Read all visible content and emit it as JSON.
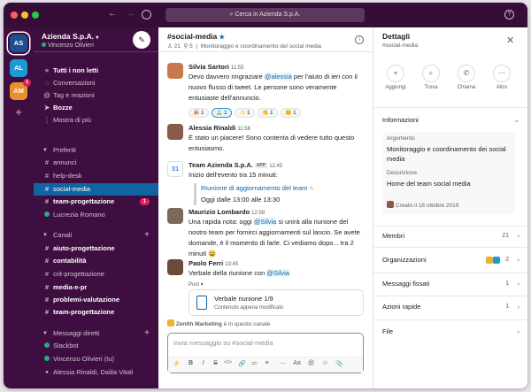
{
  "titlebar": {
    "search_placeholder": "Cerca in Azienda S.p.A.",
    "colors": {
      "close": "#ff5f57",
      "minimize": "#febc2e",
      "maximize": "#28c840"
    }
  },
  "rail": {
    "workspaces": [
      {
        "initials": "AS",
        "color": "#1d4f91",
        "selected": true
      },
      {
        "initials": "AL",
        "color": "#1d9bd1"
      },
      {
        "initials": "AM",
        "color": "#e8912d",
        "badge": "1"
      }
    ],
    "add": "+"
  },
  "sidebar": {
    "workspace_name": "Azienda S.p.A.",
    "user": "Vincenzo Olivieri",
    "nav": [
      {
        "icon": "unreads-icon",
        "glyph": "≡",
        "label": "Tutti i non letti",
        "bold": true
      },
      {
        "icon": "threads-icon",
        "glyph": "◌",
        "label": "Conversazioni"
      },
      {
        "icon": "mentions-icon",
        "glyph": "@",
        "label": "Tag e reazioni"
      },
      {
        "icon": "drafts-icon",
        "glyph": "➤",
        "label": "Bozze",
        "bold": true
      },
      {
        "icon": "more-icon",
        "glyph": "⋮",
        "label": "Mostra di più"
      }
    ],
    "favorites_header": "Preferiti",
    "favorites": [
      {
        "prefix": "#",
        "label": "annunci"
      },
      {
        "prefix": "#",
        "label": "help-desk"
      },
      {
        "prefix": "#",
        "label": "social-media",
        "selected": true
      },
      {
        "prefix": "#",
        "label": "team-progettazione",
        "bold": true,
        "badge": "1"
      },
      {
        "prefix": "dot",
        "label": "Lucrezia Romano"
      }
    ],
    "channels_header": "Canali",
    "channels": [
      {
        "label": "aiuto-progettazione",
        "bold": true
      },
      {
        "label": "contabilità",
        "bold": true
      },
      {
        "label": "crit-progettazione"
      },
      {
        "label": "media-e-pr",
        "bold": true
      },
      {
        "label": "problemi-valutazione",
        "bold": true
      },
      {
        "label": "team-progettazione",
        "bold": true
      }
    ],
    "dms_header": "Messaggi diretti",
    "dms": [
      {
        "label": "Slackbot",
        "color": "#2bac76"
      },
      {
        "label": "Vincenzo Olivieri (tu)",
        "color": "#2bac76"
      },
      {
        "label": "Alessia Rinaldi, Dalila Vitali",
        "color": "#cfc3cf"
      }
    ]
  },
  "channel": {
    "name": "#social-media",
    "star": "★",
    "members": "21",
    "pins": "5",
    "topic": "Monitoraggio e coordinamento del social media",
    "messages": [
      {
        "author": "Silvia Sartori",
        "time": "11:55",
        "avatar_color": "#c97a4a",
        "text_before": "Devo davvero ringraziare ",
        "mention": "@alessia",
        "text_after": " per l'aiuto di ieri con il nuovo flusso di tweet. Le persone sono veramente entusiaste dell'annuncio.",
        "reactions": [
          {
            "emoji": "🎉",
            "count": "1"
          },
          {
            "emoji": "🙏",
            "count": "1"
          },
          {
            "emoji": "✨",
            "count": "1"
          },
          {
            "emoji": "👏",
            "count": "1"
          },
          {
            "emoji": "😊",
            "count": "1"
          }
        ]
      },
      {
        "author": "Alessia Rinaldi",
        "time": "11:56",
        "avatar_color": "#8a5a4a",
        "text": "È stato un piacere! Sono contenta di vedere tutto questo entusiasmo."
      },
      {
        "author": "Team Azienda S.p.A.",
        "app_tag": "APP",
        "time": "12:45",
        "avatar_color": "#4285f4",
        "avatar_label": "31",
        "text": "Inizio dell'evento tra 15 minuti:",
        "event_title": "Riunione di aggiornamento del team",
        "event_time": "Oggi dalle 13:00 alle 13:30"
      },
      {
        "author": "Maurizio Lombardo",
        "time": "12:58",
        "avatar_color": "#7a6a5a",
        "text_before": "Una rapida nota: oggi ",
        "mention": "@Silvia",
        "text_after": " si unirà alla riunione del nostro team per fornirci aggiornamenti sul lancio. Se avete domande, è il momento di farle. Ci vediamo dopo... tra 2 minuti 😄"
      },
      {
        "author": "Paolo Ferri",
        "time": "13:45",
        "avatar_color": "#6a4a3a",
        "text_before": "Verbale della riunione con ",
        "mention": "@Silvia",
        "post_label": "Post ▾",
        "file_title": "Verbale riunione 1/9",
        "file_sub": "Contenuto appena modificato"
      }
    ],
    "typing_app": "Zenith Marketing",
    "typing_text": " è in questo canale",
    "composer_placeholder": "Invia messaggio su #social-media",
    "toolbar": [
      "⚡",
      "B",
      "I",
      "S",
      "</>",
      "🔗",
      "≔",
      "≡",
      "⋯",
      "Aa",
      "@",
      "☺",
      "📎"
    ]
  },
  "details": {
    "title": "Dettagli",
    "subtitle": "#social-media",
    "actions": [
      {
        "label": "Aggiungi",
        "icon": "add-person-icon",
        "glyph": "+"
      },
      {
        "label": "Trova",
        "icon": "find-icon",
        "glyph": "⌕"
      },
      {
        "label": "Chiama",
        "icon": "phone-icon",
        "glyph": "✆"
      },
      {
        "label": "Altro",
        "icon": "more-icon",
        "glyph": "⋯"
      }
    ],
    "info_header": "Informazioni",
    "topic_label": "Argomento",
    "topic_value": "Monitoraggio e coordinamento dei social media",
    "desc_label": "Descrizione",
    "desc_value": "Home del team social media",
    "created": "Creato il 18 ottobre 2019",
    "rows": [
      {
        "label": "Membri",
        "count": "21"
      },
      {
        "label": "Organizzazioni",
        "count": "2"
      },
      {
        "label": "Messaggi fissati",
        "count": "1"
      },
      {
        "label": "Azioni rapide",
        "count": "1"
      },
      {
        "label": "File",
        "count": ""
      }
    ]
  }
}
